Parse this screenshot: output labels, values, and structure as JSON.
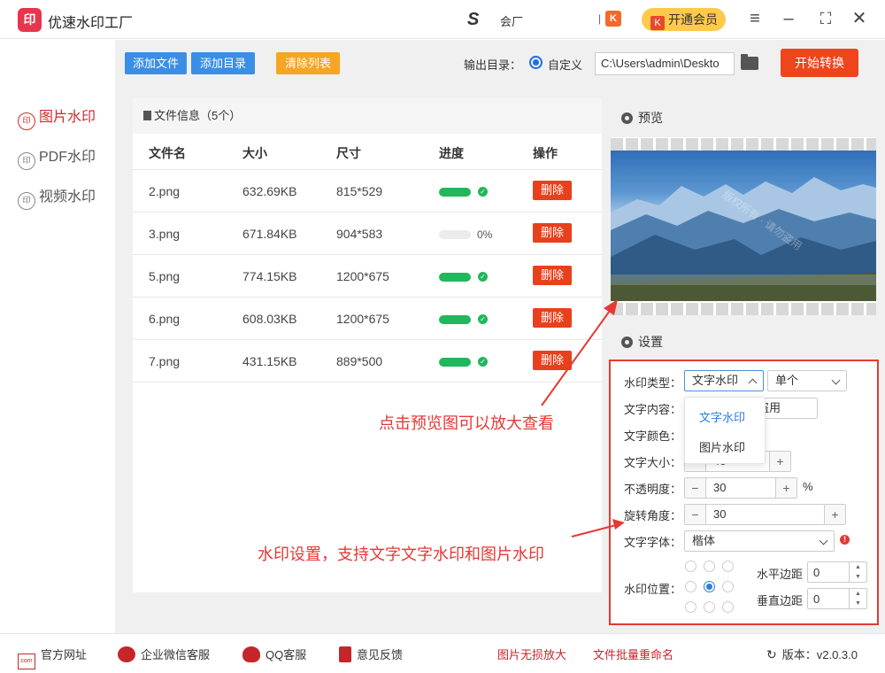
{
  "app": {
    "title": "优速水印工厂",
    "logo_text": "印",
    "partner_label": "会厂",
    "vip_label": "开通会员",
    "k_icon": "K"
  },
  "sidebar": {
    "items": [
      {
        "label": "图片水印",
        "icon": "印",
        "active": true
      },
      {
        "label": "PDF水印",
        "icon": "印"
      },
      {
        "label": "视频水印",
        "icon": "印"
      }
    ]
  },
  "toolbar": {
    "add_file": "添加文件",
    "add_dir": "添加目录",
    "clear_list": "清除列表",
    "output_label": "输出目录：",
    "radio_label": "自定义",
    "path": "C:\\Users\\admin\\Deskto",
    "start": "开始转换",
    "colors": {
      "blue": "#3a8ee6",
      "orange": "#f5a623",
      "red": "#f0441c"
    }
  },
  "files": {
    "header": "文件信息（5个）",
    "columns": [
      "文件名",
      "大小",
      "尺寸",
      "进度",
      "操作"
    ],
    "delete_label": "删除",
    "rows": [
      {
        "name": "2.png",
        "size": "632.69KB",
        "dim": "815*529",
        "progress": 1.0
      },
      {
        "name": "3.png",
        "size": "671.84KB",
        "dim": "904*583",
        "progress": 0,
        "pct": "0%"
      },
      {
        "name": "5.png",
        "size": "774.15KB",
        "dim": "1200*675",
        "progress": 1.0
      },
      {
        "name": "6.png",
        "size": "608.03KB",
        "dim": "1200*675",
        "progress": 1.0
      },
      {
        "name": "7.png",
        "size": "431.15KB",
        "dim": "889*500",
        "progress": 1.0
      }
    ]
  },
  "preview": {
    "title": "预览",
    "watermark": "版权所有 · 请勿盗用"
  },
  "settings": {
    "title": "设置",
    "type_label": "水印类型：",
    "type_value": "文字水印",
    "mode_value": "单个",
    "dropdown": [
      "文字水印",
      "图片水印"
    ],
    "content_label": "文字内容：",
    "content_value": "盗用",
    "color_label": "文字颜色：",
    "size_label": "文字大小：",
    "size_value": "40",
    "opacity_label": "不透明度：",
    "opacity_value": "30",
    "opacity_unit": "%",
    "rotate_label": "旋转角度：",
    "rotate_value": "30",
    "font_label": "文字字体：",
    "font_value": "楷体",
    "pos_label": "水印位置：",
    "hmargin_label": "水平边距",
    "hmargin_value": "0",
    "vmargin_label": "垂直边距",
    "vmargin_value": "0",
    "minus": "−",
    "plus": "+"
  },
  "annotations": {
    "preview_hint": "点击预览图可以放大查看",
    "settings_hint": "水印设置，支持文字文字水印和图片水印"
  },
  "footer": {
    "links": [
      "官方网址",
      "企业微信客服",
      "QQ客服",
      "意见反馈"
    ],
    "center_links": [
      "图片无损放大",
      "文件批量重命名"
    ],
    "version": "版本：v2.0.3.0"
  }
}
